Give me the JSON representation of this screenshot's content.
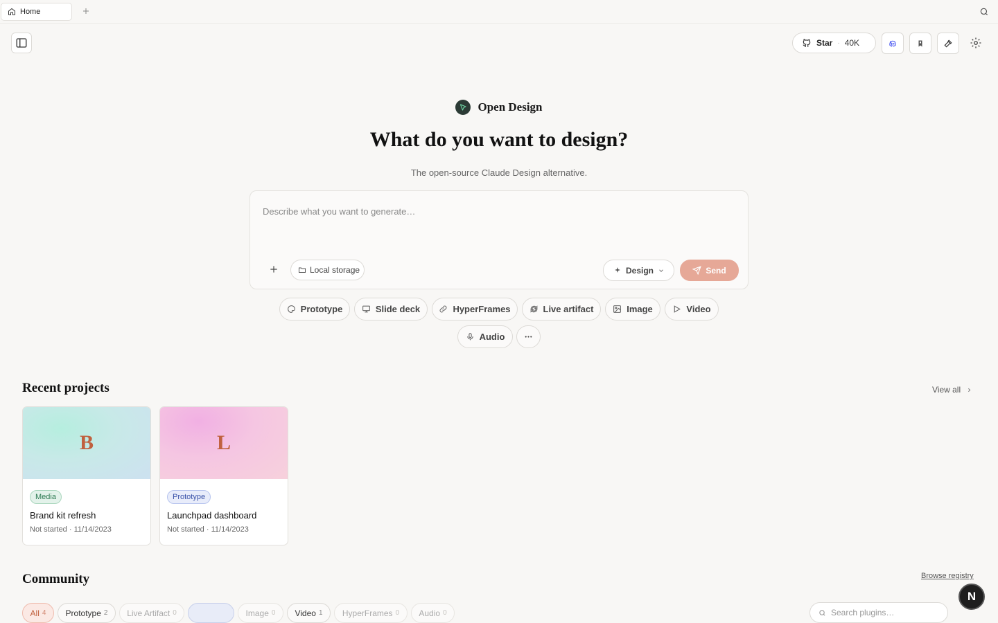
{
  "tabbar": {
    "tab_label": "Home",
    "home_icon": "home-icon",
    "add_icon": "plus-icon",
    "search_icon": "search-icon"
  },
  "header": {
    "sidebar_toggle_icon": "sidebar-icon",
    "star_label": "Star",
    "star_separator": "·",
    "star_count": "40K",
    "icons": [
      "discord-icon",
      "bookmark-icon",
      "hammer-icon",
      "gear-icon"
    ]
  },
  "hero": {
    "brand_name": "Open Design",
    "headline": "What do you want to design?",
    "subtitle": "The open-source Claude Design alternative."
  },
  "prompt": {
    "placeholder": "Describe what you want to generate…",
    "value": "",
    "attach_label": "+",
    "storage_label": "Local storage",
    "mode_label": "Design",
    "send_label": "Send"
  },
  "chips": [
    {
      "label": "Prototype",
      "icon": "palette-icon"
    },
    {
      "label": "Slide deck",
      "icon": "monitor-icon"
    },
    {
      "label": "HyperFrames",
      "icon": "link-icon"
    },
    {
      "label": "Live artifact",
      "icon": "refresh-icon"
    },
    {
      "label": "Image",
      "icon": "image-icon"
    },
    {
      "label": "Video",
      "icon": "play-icon"
    },
    {
      "label": "Audio",
      "icon": "mic-icon"
    },
    {
      "label": "",
      "icon": "more-icon"
    }
  ],
  "recent": {
    "title": "Recent projects",
    "view_all": "View all",
    "projects": [
      {
        "letter": "B",
        "badge": "Media",
        "title": "Brand kit refresh",
        "status": "Not started",
        "date": "11/14/2023"
      },
      {
        "letter": "L",
        "badge": "Prototype",
        "title": "Launchpad dashboard",
        "status": "Not started",
        "date": "11/14/2023"
      }
    ]
  },
  "community": {
    "title": "Community",
    "browse": "Browse registry",
    "filters": [
      {
        "label": "All",
        "count": "4"
      },
      {
        "label": "Prototype",
        "count": "2"
      },
      {
        "label": "Live Artifact",
        "count": "0"
      },
      {
        "label": "",
        "count": ""
      },
      {
        "label": "Image",
        "count": "0"
      },
      {
        "label": "Video",
        "count": "1"
      },
      {
        "label": "HyperFrames",
        "count": "0"
      },
      {
        "label": "Audio",
        "count": "0"
      }
    ],
    "search_placeholder": "Search plugins…"
  },
  "fab_label": "N",
  "colors": {
    "accent": "#e6a897",
    "brand_letter": "#c0613e",
    "background": "#f8f7f5"
  }
}
